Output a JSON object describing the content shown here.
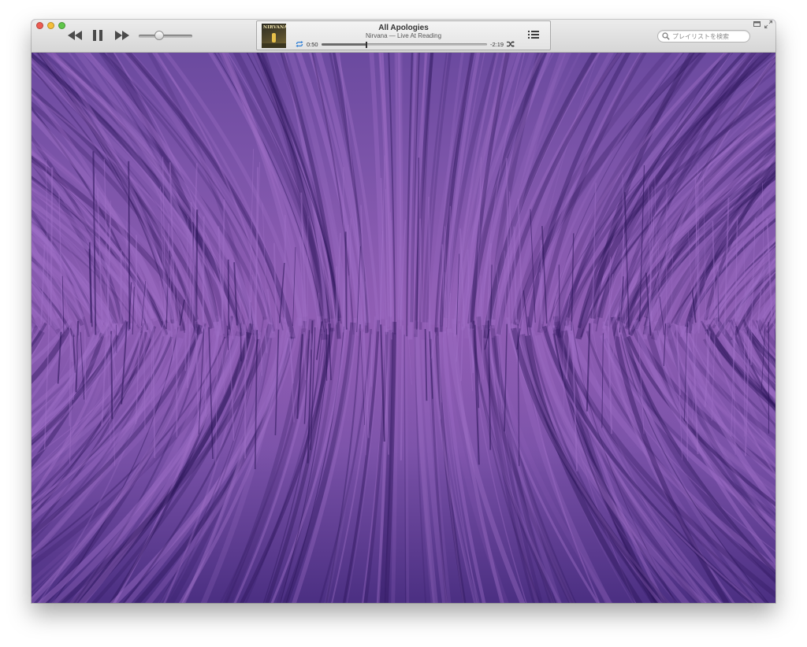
{
  "toolbar": {
    "volume_level": 0.38
  },
  "now_playing": {
    "title": "All Apologies",
    "subtitle": "Nirvana — Live At Reading",
    "elapsed": "0:50",
    "remaining": "-2:19",
    "progress": 0.27,
    "album_art_text": "NIRVANA"
  },
  "search": {
    "placeholder": "プレイリストを検索",
    "icon": "search-icon"
  },
  "visualizer": {
    "colors": {
      "base": "#7d55aa",
      "light": "#a070c8",
      "dark": "#2a1458"
    }
  },
  "icons": {
    "previous": "rewind-icon",
    "play_pause": "pause-icon",
    "next": "fast-forward-icon",
    "repeat": "repeat-icon",
    "shuffle": "shuffle-icon",
    "up_next": "list-icon",
    "mini_player": "miniplayer-icon",
    "full_screen": "fullscreen-icon"
  }
}
